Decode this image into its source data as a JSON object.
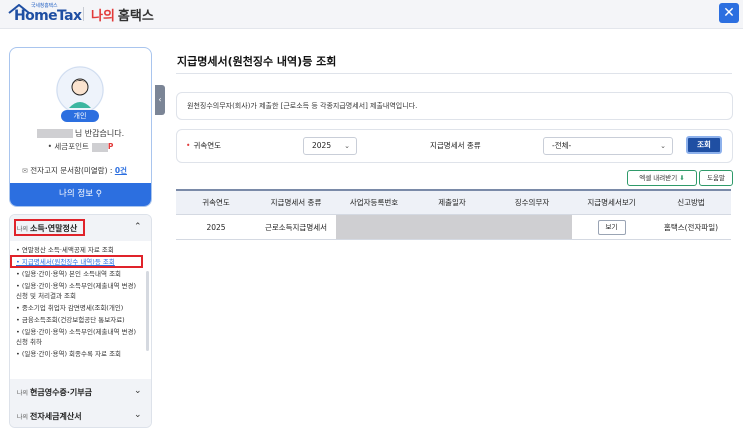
{
  "header": {
    "logo_small": "국세청홈택스",
    "logo_main": "HomeTax",
    "mytax_red": "나의",
    "mytax_dark": "홈택스",
    "close_symbol": "✕"
  },
  "profile": {
    "badge": "개인",
    "greeting": "님 반갑습니다.",
    "points_label": "• 세금포인트",
    "points_suffix": "P",
    "elec_label": "전자고지 문서함(미열람) :",
    "elec_count": "0건",
    "myinfo_button": "나의 정보"
  },
  "menu": {
    "section1_small": "나의",
    "section1_title": "소득·연말정산",
    "items": [
      "• 연말정산 소득·세액공제 자료 조회",
      "• 지급명세서(원천징수 내역)등 조회",
      "• (일용·간이·용역) 본인 소득내역 조회",
      "• (일용·간이·용역) 소득부인(제출내역 변경) 신청 및 처리결과 조회",
      "• 중소기업 취업자 감면명세(조회(개인)",
      "• 금융소득조회(건강보험공단 통보자료)",
      "• (일용·간이·용역) 소득부인(제출내역 변경) 신청 취하",
      "• (일용·간이·용역) 회종수록 자료 조회"
    ],
    "section2_small": "나의",
    "section2_title": "현금영수증·기부금",
    "section3_small": "나의",
    "section3_title": "전자세금계산서"
  },
  "main": {
    "title": "지급명세서(원천징수 내역)등 조회",
    "notice": "원천징수의무자(회사)가 제출한 [근로소득 등 각종지급명세서] 제출내역입니다.",
    "search": {
      "year_label": "귀속연도",
      "year_value": "2025",
      "type_label": "지급명세서 종류",
      "type_value": "-전체-",
      "search_button": "조회"
    },
    "excel_button": "엑셀 내려받기",
    "help_button": "도움말",
    "table": {
      "headers": [
        "귀속연도",
        "지급명세서 종류",
        "사업자등록번호",
        "제출일자",
        "징수의무자",
        "지급명세서보기",
        "신고방법"
      ],
      "row": {
        "year": "2025",
        "type": "근로소득지급명세서",
        "view_button": "보기",
        "method": "홈택스(전자파일)"
      }
    }
  },
  "colors": {
    "accent": "#2c6fe0",
    "brand_red": "#e23a3a",
    "search_button": "#1f4fa3",
    "excel_border": "#2f9a6a"
  }
}
